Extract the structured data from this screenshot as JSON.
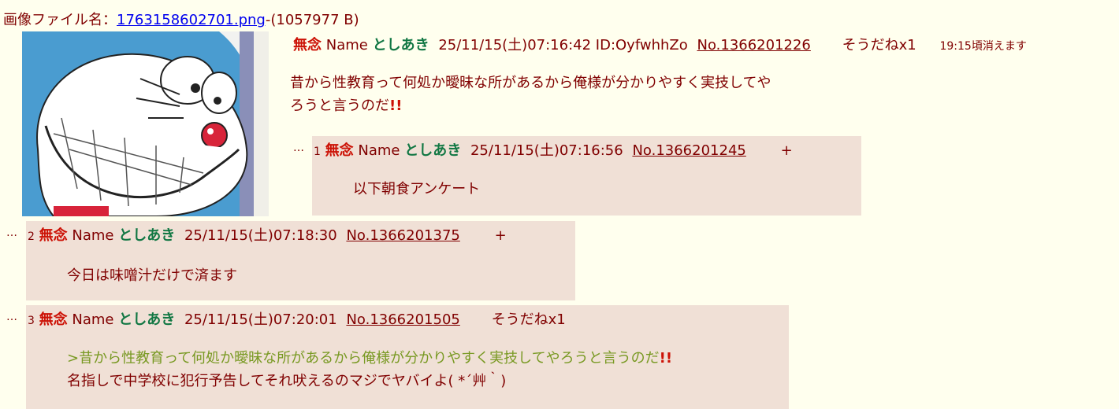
{
  "file": {
    "label": "画像ファイル名：",
    "name": "1763158602701.png",
    "size": "-(1057977 B)"
  },
  "op": {
    "subject": "無念",
    "name_label": "Name",
    "name": "としあき",
    "date": "25/11/15(土)07:16:42",
    "id": "ID:OyfwhhZo",
    "no": "No.1366201226",
    "sod": "そうだねx1",
    "expire": "19:15頃消えます",
    "line1": "昔から性教育って何処か曖昧な所があるから俺様が分かりやすく実技してや",
    "line2": "ろうと言うのだ",
    "excl": "!!"
  },
  "replies": [
    {
      "dots": "…",
      "index": "1",
      "subject": "無念",
      "name_label": "Name",
      "name": "としあき",
      "date": "25/11/15(土)07:16:56",
      "no": "No.1366201245",
      "action": "+",
      "text": "以下朝食アンケート"
    },
    {
      "dots": "…",
      "index": "2",
      "subject": "無念",
      "name_label": "Name",
      "name": "としあき",
      "date": "25/11/15(土)07:18:30",
      "no": "No.1366201375",
      "action": "+",
      "text": "今日は味噌汁だけで済ます"
    },
    {
      "dots": "…",
      "index": "3",
      "subject": "無念",
      "name_label": "Name",
      "name": "としあき",
      "date": "25/11/15(土)07:20:01",
      "no": "No.1366201505",
      "action": "そうだねx1",
      "quote": ">昔から性教育って何処か曖昧な所があるから俺様が分かりやすく実技してやろうと言うのだ",
      "quote_excl": "!!",
      "text": "名指しで中学校に犯行予告してそれ吠えるのマジでヤバイよ( *´艸｀)"
    }
  ],
  "colors": {
    "background": "#FFFFEE",
    "reply_bg": "#F0E0D6",
    "subject": "#CC1105",
    "name": "#117743",
    "text": "#800000",
    "quote": "#789922",
    "link": "#0000EE"
  },
  "thumbnail": {
    "alt_subject": "doraemon-grinning-thumbnail"
  }
}
